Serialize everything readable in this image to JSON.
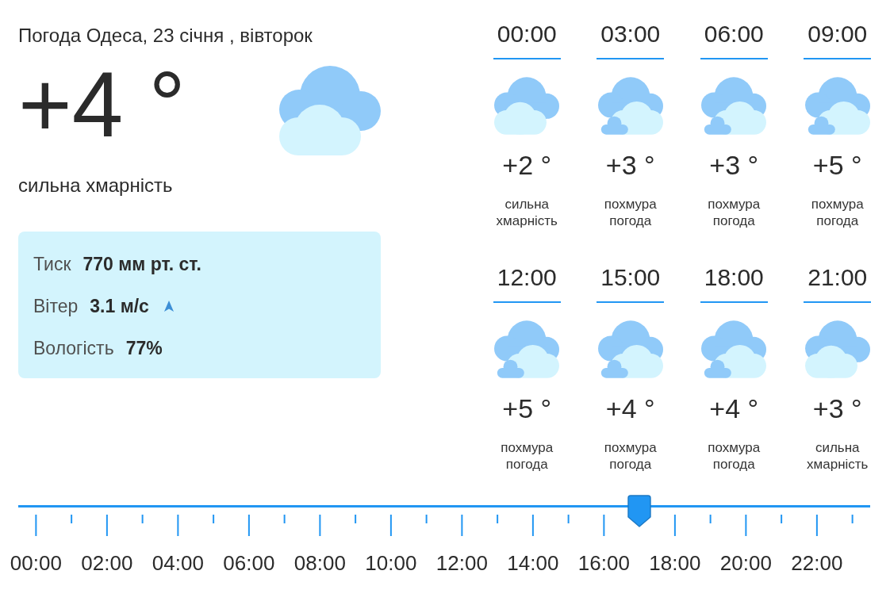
{
  "header": {
    "title": "Погода Одеса, 23 січня , вівторок"
  },
  "current": {
    "temperature": "+4 °",
    "kind": "cloudy",
    "description": "сильна хмарність"
  },
  "details": [
    {
      "kind": "plain",
      "label": "Тиск",
      "value": "770 мм рт. ст."
    },
    {
      "kind": "wind",
      "label": "Вітер",
      "value": "3.1 м/с"
    },
    {
      "kind": "plain",
      "label": "Вологість",
      "value": "77%"
    }
  ],
  "hourly": [
    {
      "time": "00:00",
      "kind": "cloudy",
      "temperature": "+2 °",
      "description": "сильна хмарність"
    },
    {
      "time": "03:00",
      "kind": "overcast",
      "temperature": "+3 °",
      "description": "похмура погода"
    },
    {
      "time": "06:00",
      "kind": "overcast",
      "temperature": "+3 °",
      "description": "похмура погода"
    },
    {
      "time": "09:00",
      "kind": "overcast",
      "temperature": "+5 °",
      "description": "похмура погода"
    },
    {
      "time": "12:00",
      "kind": "overcast",
      "temperature": "+5 °",
      "description": "похмура погода"
    },
    {
      "time": "15:00",
      "kind": "overcast",
      "temperature": "+4 °",
      "description": "похмура погода"
    },
    {
      "time": "18:00",
      "kind": "overcast",
      "temperature": "+4 °",
      "description": "похмура погода"
    },
    {
      "time": "21:00",
      "kind": "cloudy",
      "temperature": "+3 °",
      "description": "сильна хмарність"
    }
  ],
  "timeline": {
    "labels": [
      "00:00",
      "02:00",
      "04:00",
      "06:00",
      "08:00",
      "10:00",
      "12:00",
      "14:00",
      "16:00",
      "18:00",
      "20:00",
      "22:00"
    ],
    "level": 0.729
  }
}
